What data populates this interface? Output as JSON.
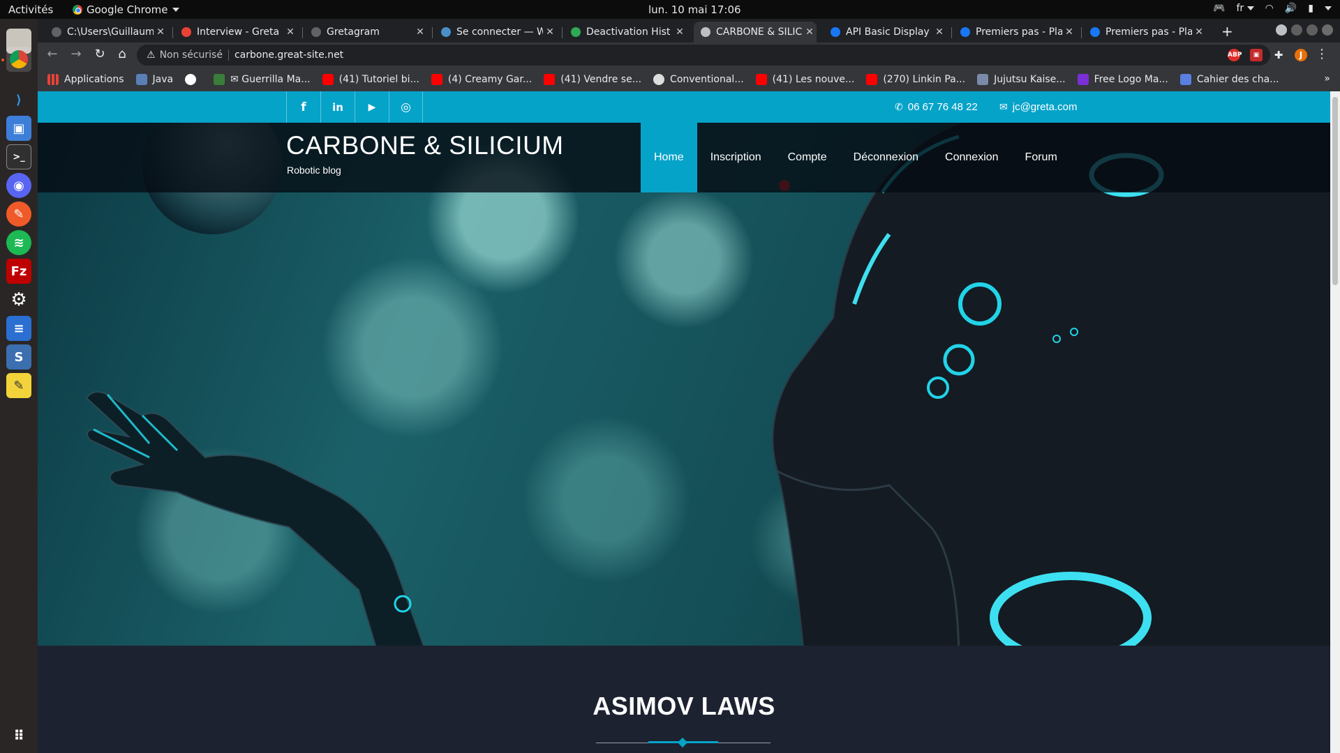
{
  "system": {
    "activities": "Activités",
    "app_name": "Google Chrome",
    "clock": "lun. 10 mai  17:06",
    "language": "fr"
  },
  "browser": {
    "tabs": [
      {
        "title": "C:\\Users\\Guillaum",
        "favicon_color": "#5f6368"
      },
      {
        "title": "Interview - Greta",
        "favicon_color": "#ea4335"
      },
      {
        "title": "Gretagram",
        "favicon_color": "#5f6368"
      },
      {
        "title": "Se connecter — W",
        "favicon_color": "#4a8fc8"
      },
      {
        "title": "Deactivation Hist",
        "favicon_color": "#2eaa55"
      },
      {
        "title": "CARBONE & SILIC",
        "favicon_color": "#bdc1c6",
        "active": true
      },
      {
        "title": "API Basic Display",
        "favicon_color": "#1877f2"
      },
      {
        "title": "Premiers pas - Pla",
        "favicon_color": "#1877f2"
      },
      {
        "title": "Premiers pas - Pla",
        "favicon_color": "#1877f2"
      }
    ],
    "address": {
      "security_label": "Non sécurisé",
      "url": "carbone.great-site.net"
    },
    "profile_initial": "J",
    "bookmarks": [
      {
        "label": "Applications",
        "icon_color": "#e94235"
      },
      {
        "label": "Java",
        "icon_color": "#5a7fb5"
      },
      {
        "label": "",
        "icon_color": "#ffffff",
        "icon": "github-icon"
      },
      {
        "label": "✉ Guerrilla Ma...",
        "icon_color": "#3a7d3a"
      },
      {
        "label": "(41) Tutoriel bi...",
        "icon_color": "#ff0000"
      },
      {
        "label": "(4) Creamy Gar...",
        "icon_color": "#ff0000"
      },
      {
        "label": "(41) Vendre se...",
        "icon_color": "#ff0000"
      },
      {
        "label": "Conventional...",
        "icon_color": "#dddddd"
      },
      {
        "label": "(41) Les nouve...",
        "icon_color": "#ff0000"
      },
      {
        "label": "(270) Linkin Pa...",
        "icon_color": "#ff0000"
      },
      {
        "label": "Jujutsu Kaise...",
        "icon_color": "#7a8aa8"
      },
      {
        "label": "Free Logo Ma...",
        "icon_color": "#7b2fd6"
      },
      {
        "label": "Cahier des cha...",
        "icon_color": "#5b7fe0"
      }
    ]
  },
  "site": {
    "title": "CARBONE & SILICIUM",
    "tagline": "Robotic blog",
    "accent": "#06a3c9",
    "social": [
      {
        "name": "facebook",
        "glyph": "f"
      },
      {
        "name": "linkedin",
        "glyph": "in"
      },
      {
        "name": "youtube",
        "glyph": "▶"
      },
      {
        "name": "instagram",
        "glyph": "◎"
      }
    ],
    "phone": "06 67 76 48 22",
    "email": "jc@greta.com",
    "nav": [
      {
        "label": "Home",
        "active": true
      },
      {
        "label": "Inscription"
      },
      {
        "label": "Compte"
      },
      {
        "label": "Déconnexion"
      },
      {
        "label": "Connexion"
      },
      {
        "label": "Forum"
      }
    ],
    "section_title": "ASIMOV LAWS"
  }
}
